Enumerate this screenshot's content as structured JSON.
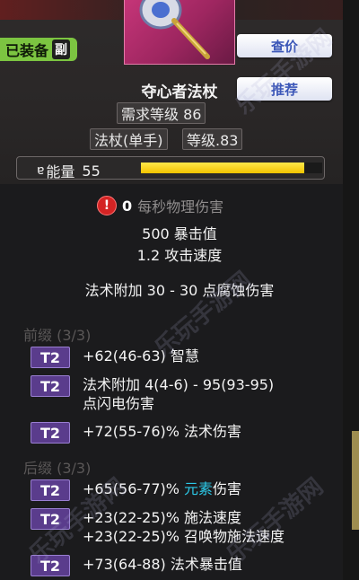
{
  "header": {
    "equip_status": "已装备",
    "sub_tag": "副",
    "btn_price": "查价",
    "btn_recommend": "推荐"
  },
  "item": {
    "name": "夺心者法杖",
    "required_level": "需求等级 86",
    "type": "法杖(单手)",
    "level": "等级.83",
    "energy_label": "能量",
    "energy_value": "55",
    "energy_fraction": 0.9
  },
  "stats": {
    "dps_value": "0",
    "dps_label": "每秒物理伤害",
    "crit": "500 暴击值",
    "attack_speed": "1.2 攻击速度",
    "spell_added": "法术附加 30 - 30 点腐蚀伤害"
  },
  "prefix": {
    "title": "前缀 (3/3)",
    "mods": [
      {
        "tier": "T2",
        "lines": [
          "+62(46-63) 智慧"
        ]
      },
      {
        "tier": "T2",
        "lines": [
          "法术附加 4(4-6) - 95(93-95)",
          "点闪电伤害"
        ]
      },
      {
        "tier": "T2",
        "lines": [
          "+72(55-76)% 法术伤害"
        ]
      }
    ]
  },
  "suffix": {
    "title": "后缀 (3/3)",
    "mod1": {
      "tier": "T2",
      "pre": "+65(56-77)% ",
      "elem": "元素",
      "post": "伤害"
    },
    "mod2": {
      "tier": "T2",
      "line1": "+23(22-25)% 施法速度",
      "line2": "+23(22-25)% 召唤物施法速度"
    },
    "mod3": {
      "tier": "T2",
      "line1": "+73(64-88) 法术暴击值"
    }
  },
  "watermark_text": "乐玩手游网",
  "colors": {
    "equip_badge": "#7cc441",
    "tier_badge": "#5a3c8c",
    "element_highlight": "#2cc9e8",
    "energy_bar": "#f2c400",
    "warning": "#d42424"
  }
}
